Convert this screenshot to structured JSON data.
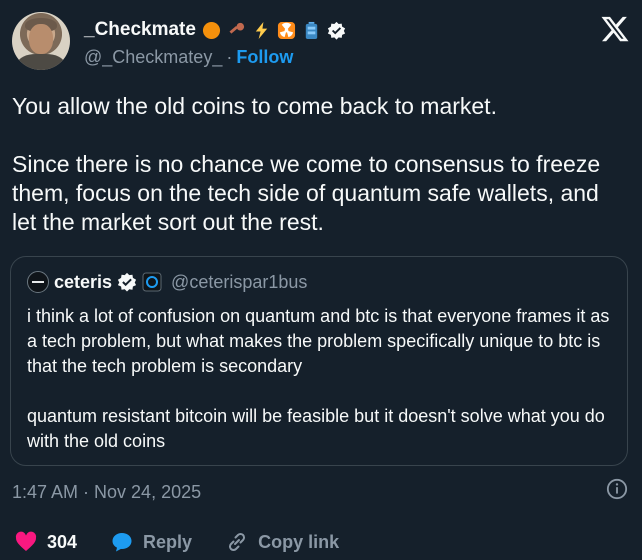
{
  "author": {
    "name": "_Checkmate",
    "handle": "@_Checkmatey_",
    "separator": "·",
    "follow_label": "Follow",
    "emojis": [
      "orange-circle",
      "key",
      "lightning",
      "radioactive",
      "battery",
      "verified-badge"
    ]
  },
  "tweet": {
    "paragraphs": [
      "You allow the old coins to come back to market.",
      "Since there is no chance we come to consensus to freeze them, focus on the tech side of quantum safe wallets, and let the market sort out the rest."
    ]
  },
  "quote": {
    "name": "ceteris",
    "handle": "@ceterispar1bus",
    "paragraphs": [
      "i think a lot of confusion on quantum and btc is that everyone frames it as a tech problem, but what makes the problem specifically unique to btc is that the tech problem is secondary",
      "quantum resistant bitcoin will be feasible but it doesn't solve what you do with the old coins"
    ]
  },
  "meta": {
    "timestamp": "1:47 AM · Nov 24, 2025"
  },
  "actions": {
    "likes": "304",
    "reply_label": "Reply",
    "copy_label": "Copy link"
  },
  "colors": {
    "background": "#15202b",
    "accent": "#1d9bf0",
    "like": "#f91880",
    "muted": "#8b98a5"
  }
}
